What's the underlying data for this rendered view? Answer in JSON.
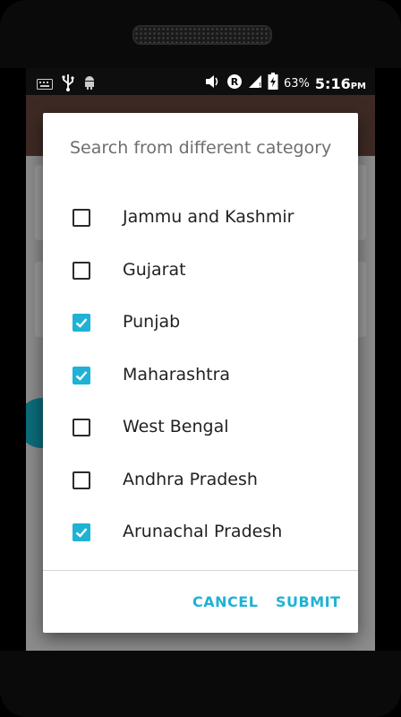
{
  "status_bar": {
    "battery": "63%",
    "time": "5:16",
    "ampm": "PM",
    "icons": [
      "keyboard-icon",
      "usb-icon",
      "android-icon",
      "volume-icon",
      "roaming-icon",
      "signal-icon",
      "battery-charging-icon"
    ]
  },
  "dialog": {
    "title": "Search from different category",
    "options": [
      {
        "label": "Jammu and Kashmir",
        "checked": false
      },
      {
        "label": "Gujarat",
        "checked": false
      },
      {
        "label": "Punjab",
        "checked": true
      },
      {
        "label": "Maharashtra",
        "checked": true
      },
      {
        "label": "West Bengal",
        "checked": false
      },
      {
        "label": "Andhra Pradesh",
        "checked": false
      },
      {
        "label": "Arunachal Pradesh",
        "checked": true
      }
    ],
    "cancel_label": "CANCEL",
    "submit_label": "SUBMIT"
  },
  "colors": {
    "accent": "#1fb2d4",
    "app_bar": "#3e2a24"
  }
}
